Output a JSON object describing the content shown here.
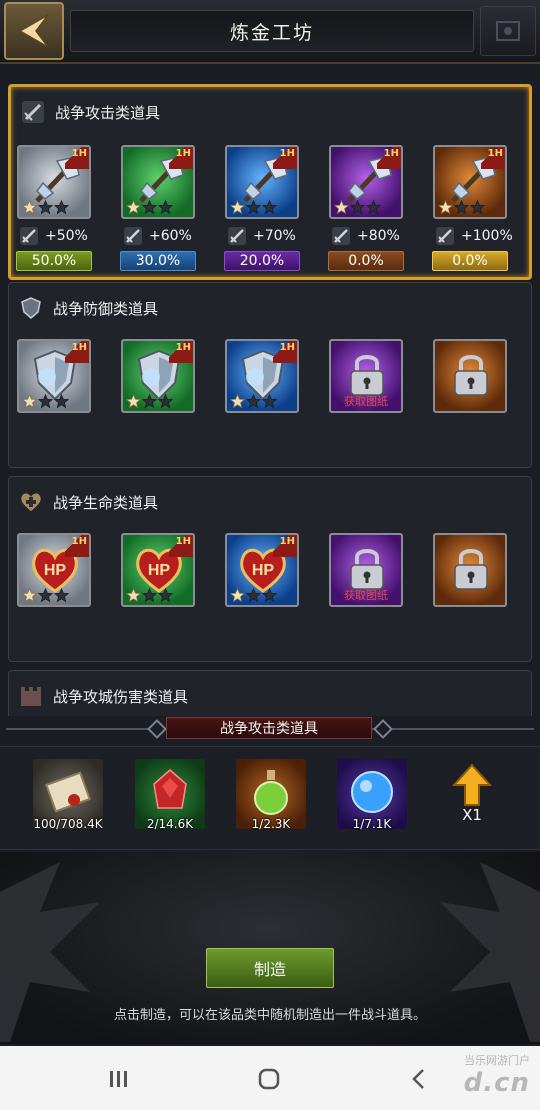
{
  "header": {
    "title": "炼金工坊"
  },
  "categories": [
    {
      "title": "战争攻击类道具",
      "selected": true,
      "items": [
        {
          "quality": "white",
          "tag": "1H",
          "stars": 1
        },
        {
          "quality": "green",
          "tag": "1H",
          "stars": 1
        },
        {
          "quality": "blue",
          "tag": "1H",
          "stars": 1
        },
        {
          "quality": "purple",
          "tag": "1H",
          "stars": 1
        },
        {
          "quality": "orange",
          "tag": "1H",
          "stars": 1
        }
      ],
      "bonuses": [
        "+50%",
        "+60%",
        "+70%",
        "+80%",
        "+100%"
      ],
      "rates": [
        "50.0%",
        "30.0%",
        "20.0%",
        "0.0%",
        "0.0%"
      ]
    },
    {
      "title": "战争防御类道具",
      "items": [
        {
          "quality": "white",
          "tag": "1H",
          "stars": 1
        },
        {
          "quality": "green",
          "tag": "1H",
          "stars": 1
        },
        {
          "quality": "blue",
          "tag": "1H",
          "stars": 1
        },
        {
          "quality": "purple",
          "locked": true,
          "label": "获取图纸"
        },
        {
          "quality": "orange",
          "locked": true
        }
      ]
    },
    {
      "title": "战争生命类道具",
      "items": [
        {
          "quality": "white",
          "tag": "1H",
          "stars": 1,
          "icon_text": "HP"
        },
        {
          "quality": "green",
          "tag": "1H",
          "stars": 1,
          "icon_text": "HP"
        },
        {
          "quality": "blue",
          "tag": "1H",
          "stars": 1,
          "icon_text": "HP"
        },
        {
          "quality": "purple",
          "locked": true,
          "label": "获取图纸"
        },
        {
          "quality": "orange",
          "locked": true
        }
      ]
    },
    {
      "title": "战争攻城伤害类道具"
    }
  ],
  "selection_label": "战争攻击类道具",
  "materials": [
    {
      "icon": "scroll-icon",
      "count": "100/708.4K"
    },
    {
      "icon": "ruby-icon",
      "count": "2/14.6K"
    },
    {
      "icon": "potion-icon",
      "count": "1/2.3K"
    },
    {
      "icon": "orb-icon",
      "count": "1/7.1K"
    }
  ],
  "multiplier": "X1",
  "make_button": "制造",
  "hint": "点击制造，可以在该品类中随机制造出一件战斗道具。",
  "watermark": {
    "small": "当乐网游门户",
    "large": "d.cn"
  },
  "colors": {
    "selected_border": "#d4a02a",
    "make_button": "#5b8a24",
    "locked_label": "#e04848"
  }
}
